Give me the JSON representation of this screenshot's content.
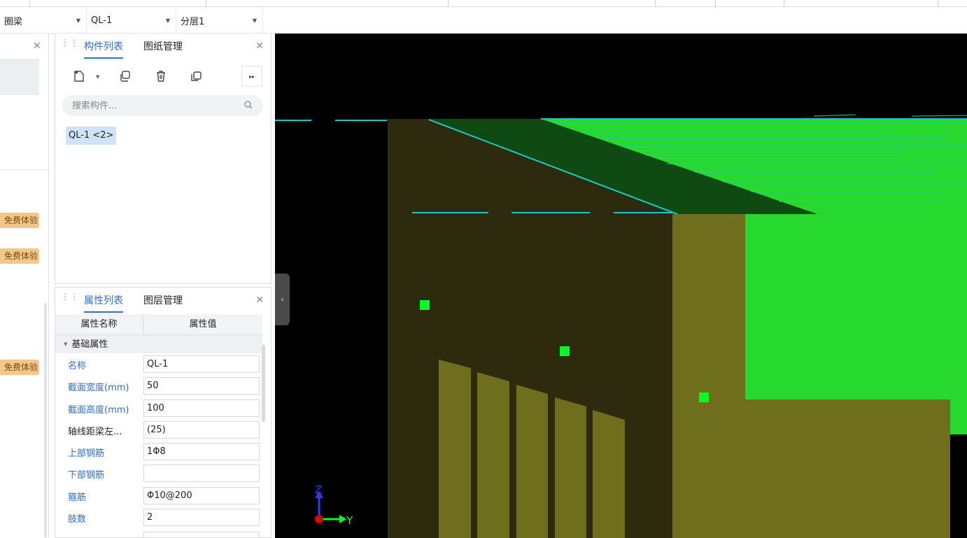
{
  "selector_bar": {
    "type_value": "圈梁",
    "component_value": "QL-1",
    "layer_value": "分层1"
  },
  "left_panel": {
    "trial_badges": [
      "免费体验",
      "免费体验",
      "免费体验"
    ]
  },
  "component_panel": {
    "tabs": [
      {
        "label": "构件列表",
        "active": true
      },
      {
        "label": "图纸管理",
        "active": false
      }
    ],
    "search_placeholder": "搜索构件...",
    "items": [
      {
        "label": "QL-1 <2>"
      }
    ]
  },
  "property_panel": {
    "tabs": [
      {
        "label": "属性列表",
        "active": true
      },
      {
        "label": "图层管理",
        "active": false
      }
    ],
    "columns": [
      "属性名称",
      "属性值"
    ],
    "group": "基础属性",
    "rows": [
      {
        "name": "名称",
        "value": "QL-1",
        "link": true
      },
      {
        "name": "截面宽度(mm)",
        "value": "50",
        "link": true
      },
      {
        "name": "截面高度(mm)",
        "value": "100",
        "link": true
      },
      {
        "name": "轴线距梁左...",
        "value": "(25)",
        "link": false
      },
      {
        "name": "上部钢筋",
        "value": "1Φ8",
        "link": true
      },
      {
        "name": "下部钢筋",
        "value": "",
        "link": true
      },
      {
        "name": "箍筋",
        "value": "Φ10@200",
        "link": true
      },
      {
        "name": "肢数",
        "value": "2",
        "link": true
      }
    ]
  },
  "viewport": {
    "axis_labels": {
      "z": "Z",
      "y": "Y"
    },
    "colors": {
      "background": "#000000",
      "slab_green": "#27d92e",
      "dark_green": "#0f4a12",
      "wall_olive": "#6f6e1d",
      "wall_dark": "#2e2a0e",
      "rebar_cyan": "#1fc8c8",
      "point_green": "#00ff22"
    }
  },
  "accent_color": "#2e6fd6"
}
